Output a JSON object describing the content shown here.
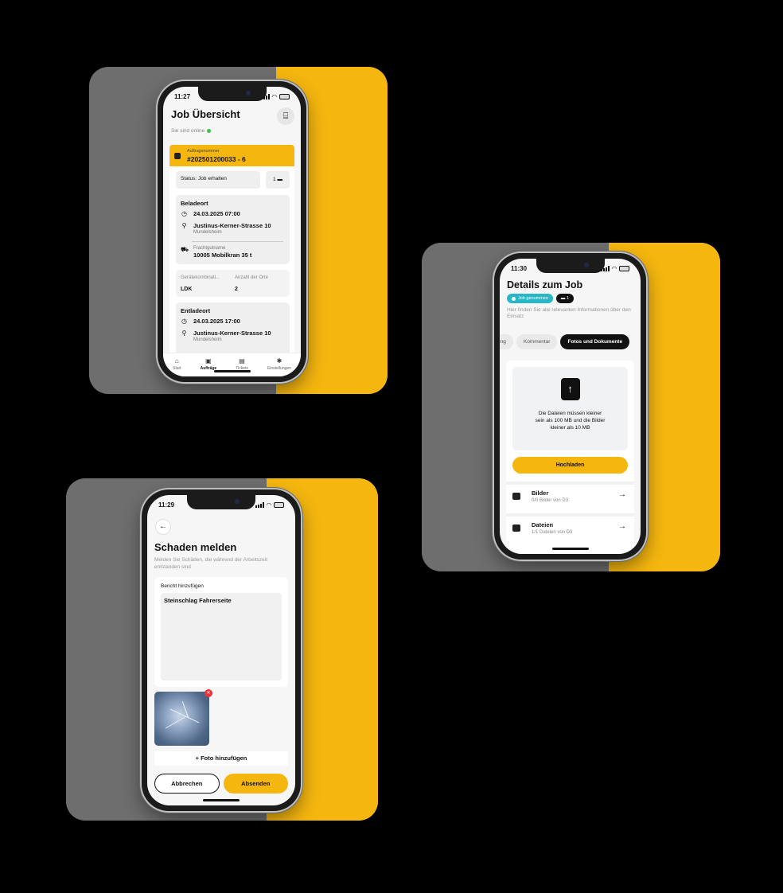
{
  "colors": {
    "accent": "#f5b60f",
    "teal": "#27b7c7",
    "dark": "#111111",
    "card_gray": "#6e6e6e",
    "online": "#3fbf4a",
    "delete": "#e8343a"
  },
  "phone1": {
    "time": "11:27",
    "title": "Job Übersicht",
    "scan_icon": "scan-icon",
    "online_text": "Sie sind online",
    "order": {
      "label": "Auftragsnummer",
      "number": "#202501200033 - 6"
    },
    "status_text": "Status: Job erhalten",
    "doc_count": "1",
    "loading": {
      "heading": "Beladeort",
      "datetime": "24.03.2025 07:00",
      "street": "Justinus-Kerner-Strasse 10",
      "city": "Mundelsheim",
      "freight_label": "Frachtgutname",
      "freight_value": "10005 Mobilkran 35 t"
    },
    "combo": {
      "key1": "Gerätekombinati...",
      "val1": "LDK",
      "key2": "Anzahl der Orte",
      "val2": "2"
    },
    "unloading": {
      "heading": "Entladeort",
      "datetime": "24.03.2025 17:00",
      "street": "Justinus-Kerner-Strasse 10",
      "city": "Mundelsheim"
    },
    "tabs": [
      {
        "label": "Start",
        "icon": "home-icon"
      },
      {
        "label": "Aufträge",
        "icon": "briefcase-icon"
      },
      {
        "label": "Tickets",
        "icon": "ticket-icon"
      },
      {
        "label": "Einstellungen",
        "icon": "gear-icon"
      }
    ]
  },
  "phone2": {
    "time": "11:30",
    "title": "Details zum Job",
    "badge_status": "Job genommen",
    "badge_count": "1",
    "subtitle": "Hier finden Sie alle relevanten Informationen über den Einsatz",
    "tabs": [
      "ung",
      "Kommentar",
      "Fotos und Dokumente"
    ],
    "upload_hint": "Die Dateien müssen kleiner sein als 100 MB und die Bilder kleiner als 10 MB",
    "upload_button": "Hochladen",
    "items": [
      {
        "title": "Bilder",
        "sub": "0/0 Bilder von D3",
        "icon": "image-icon"
      },
      {
        "title": "Dateien",
        "sub": "1/1 Dateien von D3",
        "icon": "folder-icon"
      }
    ]
  },
  "phone3": {
    "time": "11:29",
    "title": "Schaden melden",
    "subtitle": "Melden Sie Schäden, die während der Arbeitszeit entstanden sind",
    "report_label": "Bericht hinzufügen",
    "report_text": "Steinschlag Fahrerseite",
    "add_photo": "+ Foto hinzufügen",
    "cancel": "Abbrechen",
    "send": "Absenden"
  }
}
